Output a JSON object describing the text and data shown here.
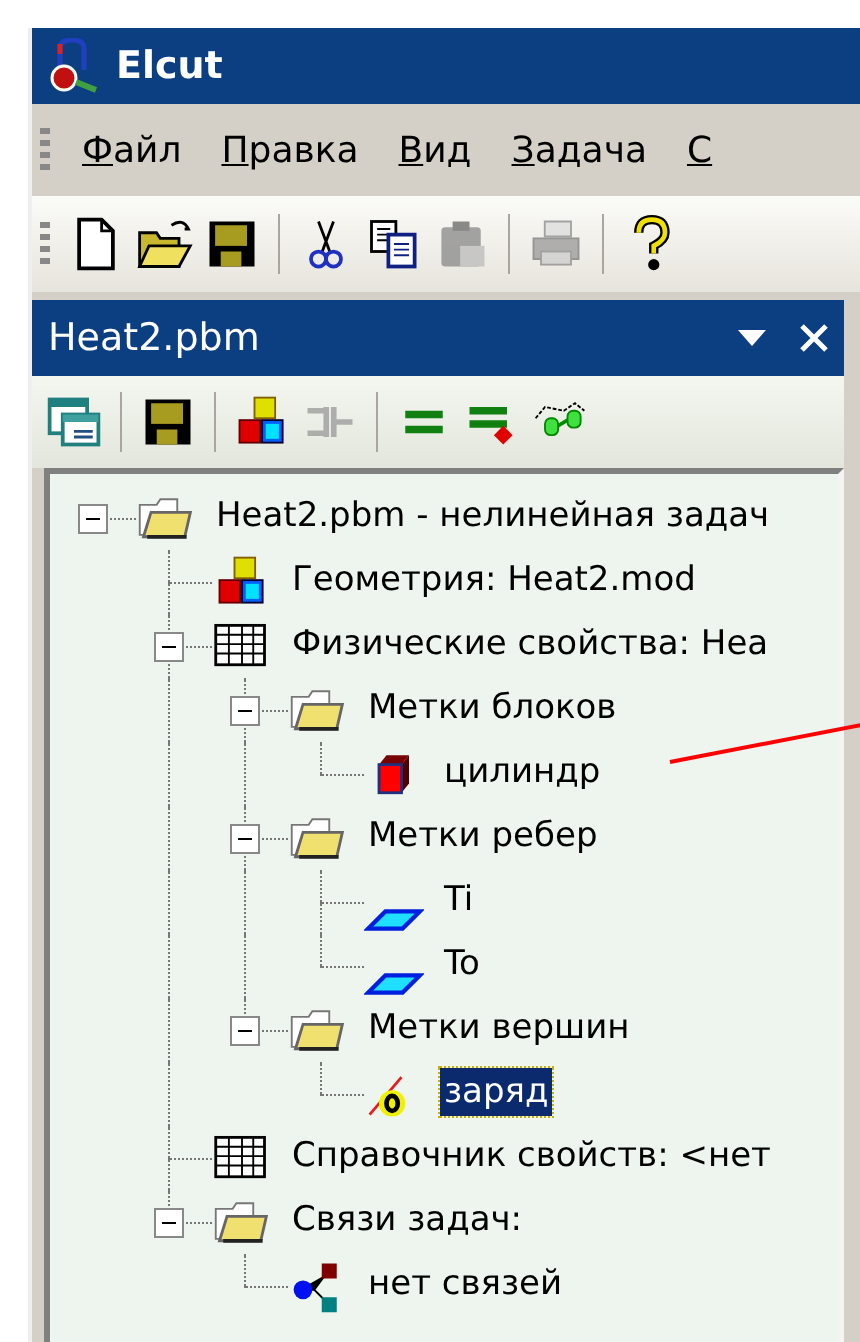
{
  "window": {
    "title": "Elcut"
  },
  "menu": [
    {
      "label": "Файл"
    },
    {
      "label": "Правка"
    },
    {
      "label": "Вид"
    },
    {
      "label": "Задача"
    },
    {
      "label": "С"
    }
  ],
  "toolbar": [
    {
      "kind": "new",
      "disabled": false
    },
    {
      "kind": "open",
      "disabled": false
    },
    {
      "kind": "save",
      "disabled": false
    },
    {
      "kind": "separator",
      "disabled": false
    },
    {
      "kind": "cut",
      "disabled": false
    },
    {
      "kind": "copy",
      "disabled": false
    },
    {
      "kind": "paste",
      "disabled": true
    },
    {
      "kind": "separator",
      "disabled": false
    },
    {
      "kind": "print",
      "disabled": true
    },
    {
      "kind": "separator",
      "disabled": false
    },
    {
      "kind": "help",
      "disabled": false
    }
  ],
  "panel": {
    "title": "Heat2.pbm",
    "toolbar": [
      {
        "kind": "window",
        "disabled": false
      },
      {
        "kind": "separator",
        "disabled": false
      },
      {
        "kind": "save",
        "disabled": false
      },
      {
        "kind": "separator",
        "disabled": false
      },
      {
        "kind": "geometry",
        "disabled": false
      },
      {
        "kind": "connect",
        "disabled": true
      },
      {
        "kind": "separator",
        "disabled": false
      },
      {
        "kind": "equal",
        "disabled": false
      },
      {
        "kind": "equal-dot",
        "disabled": false
      },
      {
        "kind": "glasses",
        "disabled": false
      }
    ],
    "tree": [
      {
        "label": "Heat2.pbm - нелинейная задач",
        "kind": "folder",
        "expanded": true,
        "selected": false,
        "children": [
          {
            "label": "Геометрия: Heat2.mod",
            "kind": "geometry",
            "selected": false
          },
          {
            "label": "Физические свойства: Hea",
            "kind": "table",
            "expanded": true,
            "selected": false,
            "children": [
              {
                "label": "Метки блоков",
                "kind": "folder",
                "expanded": true,
                "selected": false,
                "children": [
                  {
                    "label": "цилиндр",
                    "kind": "block",
                    "selected": false
                  }
                ]
              },
              {
                "label": "Метки ребер",
                "kind": "folder",
                "expanded": true,
                "selected": false,
                "children": [
                  {
                    "label": "Ti",
                    "kind": "edge",
                    "selected": false
                  },
                  {
                    "label": "To",
                    "kind": "edge",
                    "selected": false
                  }
                ]
              },
              {
                "label": "Метки вершин",
                "kind": "folder",
                "expanded": true,
                "selected": false,
                "children": [
                  {
                    "label": "заряд",
                    "kind": "vertex",
                    "selected": true
                  }
                ]
              }
            ]
          },
          {
            "label": "Справочник свойств: <нет",
            "kind": "table",
            "selected": false
          },
          {
            "label": "Связи задач:",
            "kind": "folder",
            "expanded": true,
            "selected": false,
            "children": [
              {
                "label": "нет связей",
                "kind": "links",
                "selected": false
              }
            ]
          }
        ]
      }
    ]
  }
}
